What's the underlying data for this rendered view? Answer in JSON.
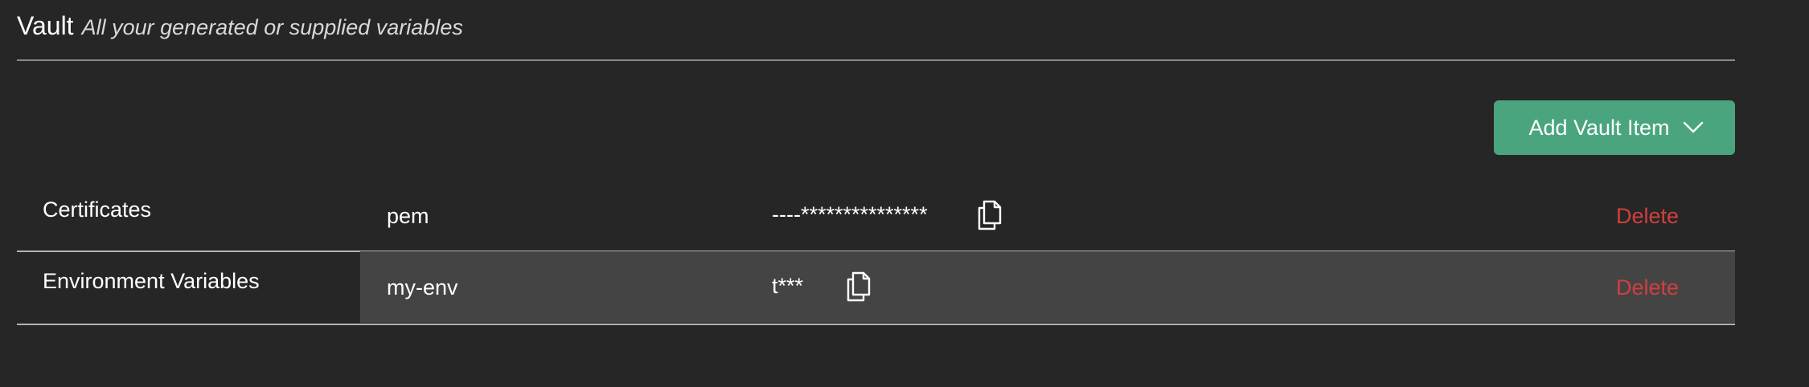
{
  "header": {
    "title": "Vault",
    "subtitle": "All your generated or supplied variables"
  },
  "toolbar": {
    "add_label": "Add Vault Item",
    "add_icon": "chevron-down-icon"
  },
  "colors": {
    "background": "#262626",
    "accent": "#4aa57f",
    "danger": "#d23f3f",
    "row_highlight": "#444444"
  },
  "rows": [
    {
      "category": "Certificates",
      "name": "pem",
      "value": "----***************",
      "copy_icon": "copy-icon",
      "delete_label": "Delete"
    },
    {
      "category": "Environment Variables",
      "name": "my-env",
      "value": "t***",
      "copy_icon": "copy-icon",
      "delete_label": "Delete"
    }
  ]
}
